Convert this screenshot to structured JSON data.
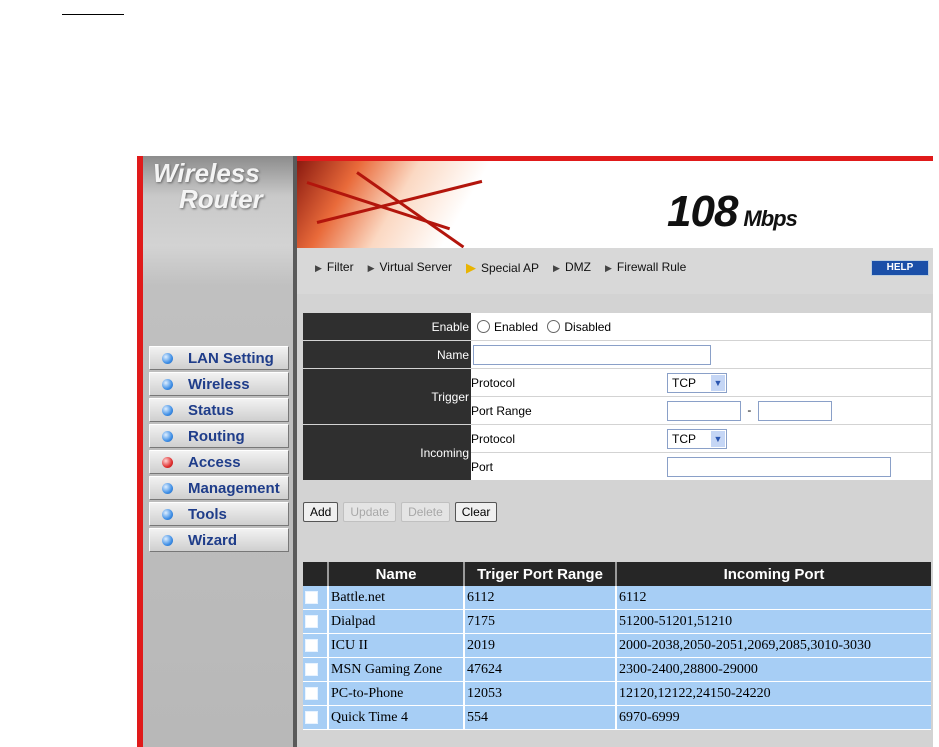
{
  "brand": {
    "line1": "Wireless",
    "line2": "Router"
  },
  "banner": {
    "speed": "108",
    "unit": "Mbps"
  },
  "nav": {
    "items": [
      "Filter",
      "Virtual Server",
      "Special AP",
      "DMZ",
      "Firewall Rule"
    ],
    "active": "Special AP",
    "help_label": "HELP"
  },
  "sidebar": {
    "items": [
      {
        "label": "LAN Setting"
      },
      {
        "label": "Wireless"
      },
      {
        "label": "Status"
      },
      {
        "label": "Routing"
      },
      {
        "label": "Access"
      },
      {
        "label": "Management"
      },
      {
        "label": "Tools"
      },
      {
        "label": "Wizard"
      }
    ],
    "active": "Access"
  },
  "form": {
    "enable_label": "Enable",
    "enabled_label": "Enabled",
    "disabled_label": "Disabled",
    "name_label": "Name",
    "name_value": "",
    "trigger_label": "Trigger",
    "incoming_label": "Incoming",
    "protocol_label": "Protocol",
    "port_range_label": "Port Range",
    "port_label": "Port",
    "trigger_protocol": "TCP",
    "incoming_protocol": "TCP",
    "range_separator": "-"
  },
  "buttons": {
    "add": "Add",
    "update": "Update",
    "delete": "Delete",
    "clear": "Clear"
  },
  "table": {
    "headers": [
      "Name",
      "Triger Port Range",
      "Incoming Port"
    ],
    "rows": [
      [
        "Battle.net",
        "6112",
        "6112"
      ],
      [
        "Dialpad",
        "7175",
        "51200-51201,51210"
      ],
      [
        "ICU II",
        "2019",
        "2000-2038,2050-2051,2069,2085,3010-3030"
      ],
      [
        "MSN Gaming Zone",
        "47624",
        "2300-2400,28800-29000"
      ],
      [
        "PC-to-Phone",
        "12053",
        "12120,12122,24150-24220"
      ],
      [
        "Quick Time 4",
        "554",
        "6970-6999"
      ]
    ]
  },
  "colors": {
    "accent": "#e01a1a",
    "header": "#2f2f2f",
    "row": "#a7cef5",
    "menu_text": "#1f3d8a"
  }
}
